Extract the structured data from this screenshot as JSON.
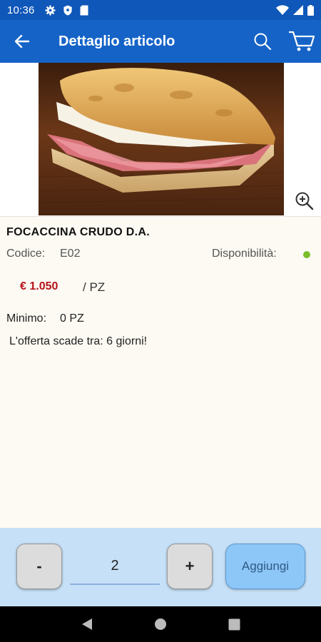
{
  "status_bar": {
    "time": "10:36"
  },
  "header": {
    "title": "Dettaglio articolo"
  },
  "product": {
    "name": "FOCACCINA CRUDO D.A.",
    "code_label": "Codice:",
    "code_value": "E02",
    "availability_label": "Disponibilità:",
    "availability_color": "#7cbd2c",
    "price": "€ 1.050",
    "unit": "/ PZ",
    "minimo_label": "Minimo:",
    "minimo_value": "0 PZ",
    "offer_text": "L'offerta scade tra: 6 giorni!"
  },
  "quantity": {
    "minus_label": "-",
    "value": "2",
    "plus_label": "+",
    "add_label": "Aggiungi"
  },
  "colors": {
    "primary": "#1563c7",
    "status_bar": "#0f57b8",
    "price_red": "#b5121b",
    "panel": "#c6e0f7",
    "add_button": "#8dc7f7"
  },
  "icons": {
    "back": "arrow-left-icon",
    "search": "search-icon",
    "cart": "cart-icon",
    "zoom": "zoom-in-icon"
  }
}
